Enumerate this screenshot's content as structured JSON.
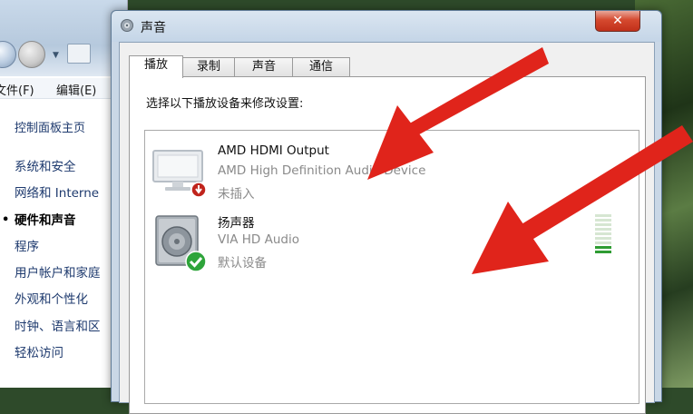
{
  "control_panel": {
    "menu": {
      "file": "文件(F)",
      "edit": "编辑(E)"
    },
    "home_link": "控制面板主页",
    "categories": [
      {
        "label": "系统和安全",
        "active": false
      },
      {
        "label": "网络和 Interne",
        "active": false
      },
      {
        "label": "硬件和声音",
        "active": true
      },
      {
        "label": "程序",
        "active": false
      },
      {
        "label": "用户帐户和家庭",
        "active": false
      },
      {
        "label": "外观和个性化",
        "active": false
      },
      {
        "label": "时钟、语言和区",
        "active": false
      },
      {
        "label": "轻松访问",
        "active": false
      }
    ],
    "active_bullet": "•"
  },
  "dialog": {
    "title": "声音",
    "close_glyph": "✕",
    "tabs": [
      "播放",
      "录制",
      "声音",
      "通信"
    ],
    "active_tab": "播放",
    "instruction": "选择以下播放设备来修改设置:",
    "devices": [
      {
        "name": "AMD HDMI Output",
        "driver": "AMD High Definition Audio Device",
        "status": "未插入",
        "icon": "monitor-icon",
        "badge": "unplugged-badge-icon"
      },
      {
        "name": "扬声器",
        "driver": "VIA HD Audio",
        "status": "默认设备",
        "icon": "speaker-icon",
        "badge": "default-checkmark-icon",
        "level_bars_lit": 2,
        "level_bars_total": 9
      }
    ]
  },
  "colors": {
    "arrow": "#e0241b",
    "checkmark": "#2ea43a",
    "unplugged": "#c0241c"
  }
}
